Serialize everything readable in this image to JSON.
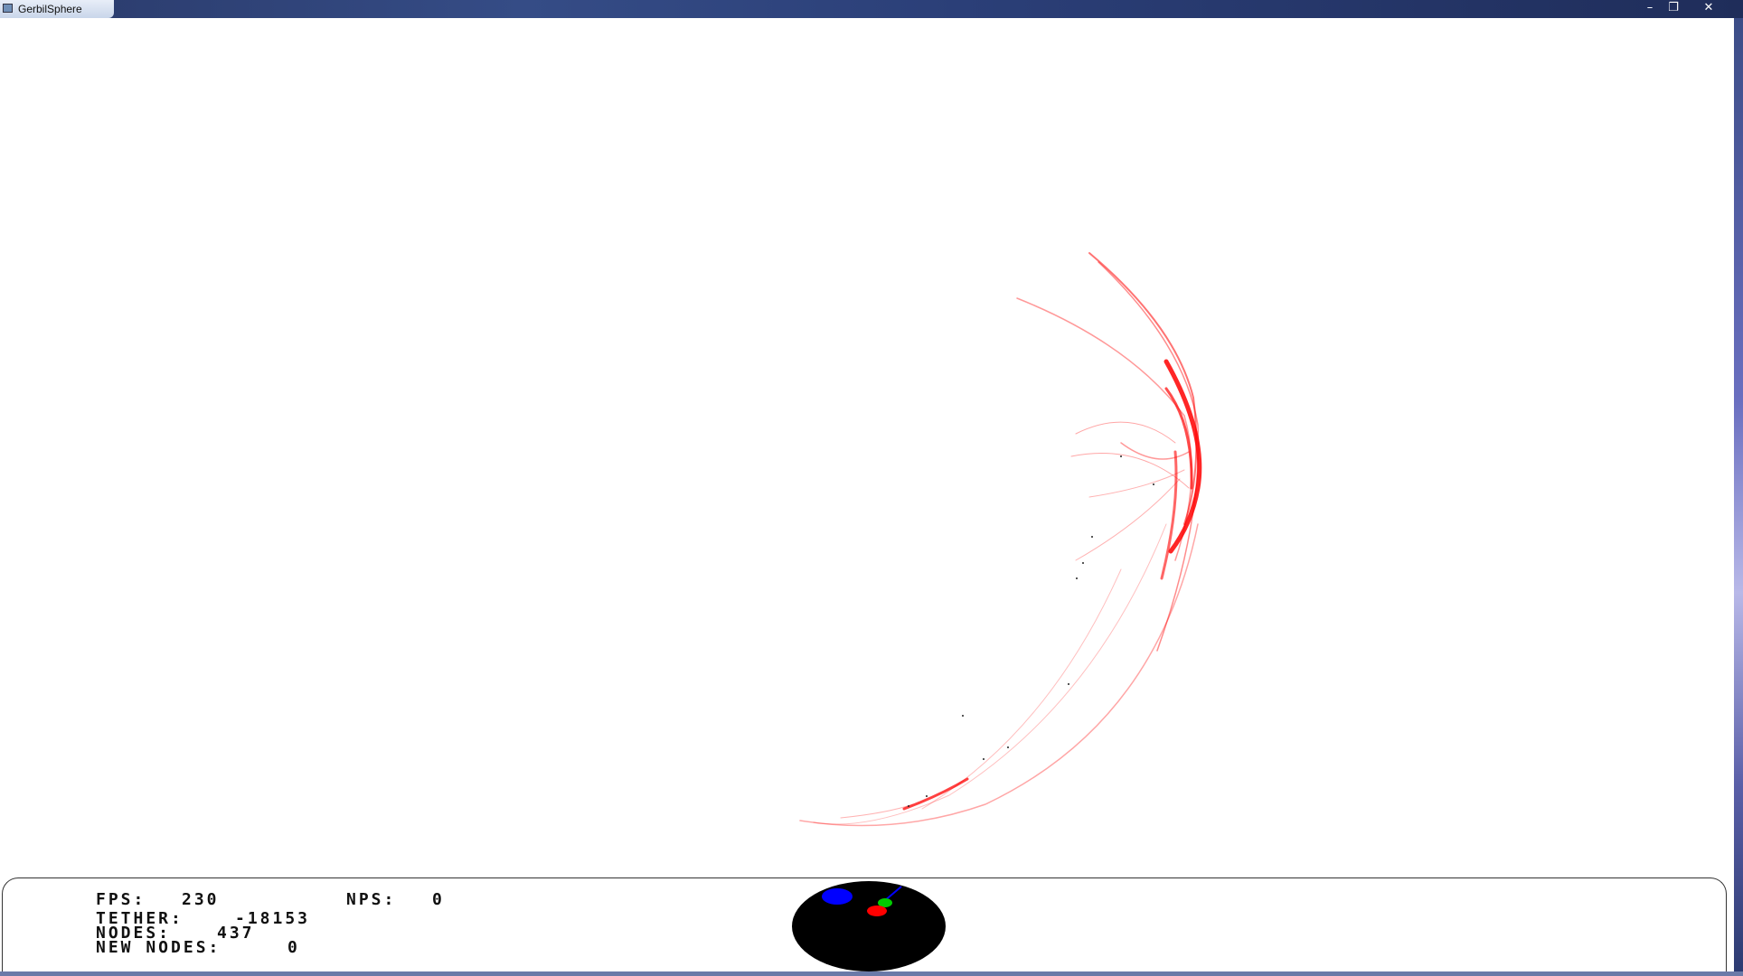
{
  "window": {
    "title": "GerbilSphere",
    "controls": {
      "minimize": "–",
      "maximize": "❐",
      "close": "✕"
    }
  },
  "hud": {
    "fps_label": "FPS:",
    "fps_value": "230",
    "nps_label": "NPS:",
    "nps_value": "0",
    "tether_label": "TETHER:",
    "tether_value": "-18153",
    "nodes_label": "NODES:",
    "nodes_value": "437",
    "new_nodes_label": "NEW NODES:",
    "new_nodes_value": "0"
  },
  "colors": {
    "filament": "#ff0000",
    "radar_bg": "#000000",
    "radar_blue": "#0000ff",
    "radar_green": "#00cc00",
    "radar_red": "#ff0000"
  }
}
